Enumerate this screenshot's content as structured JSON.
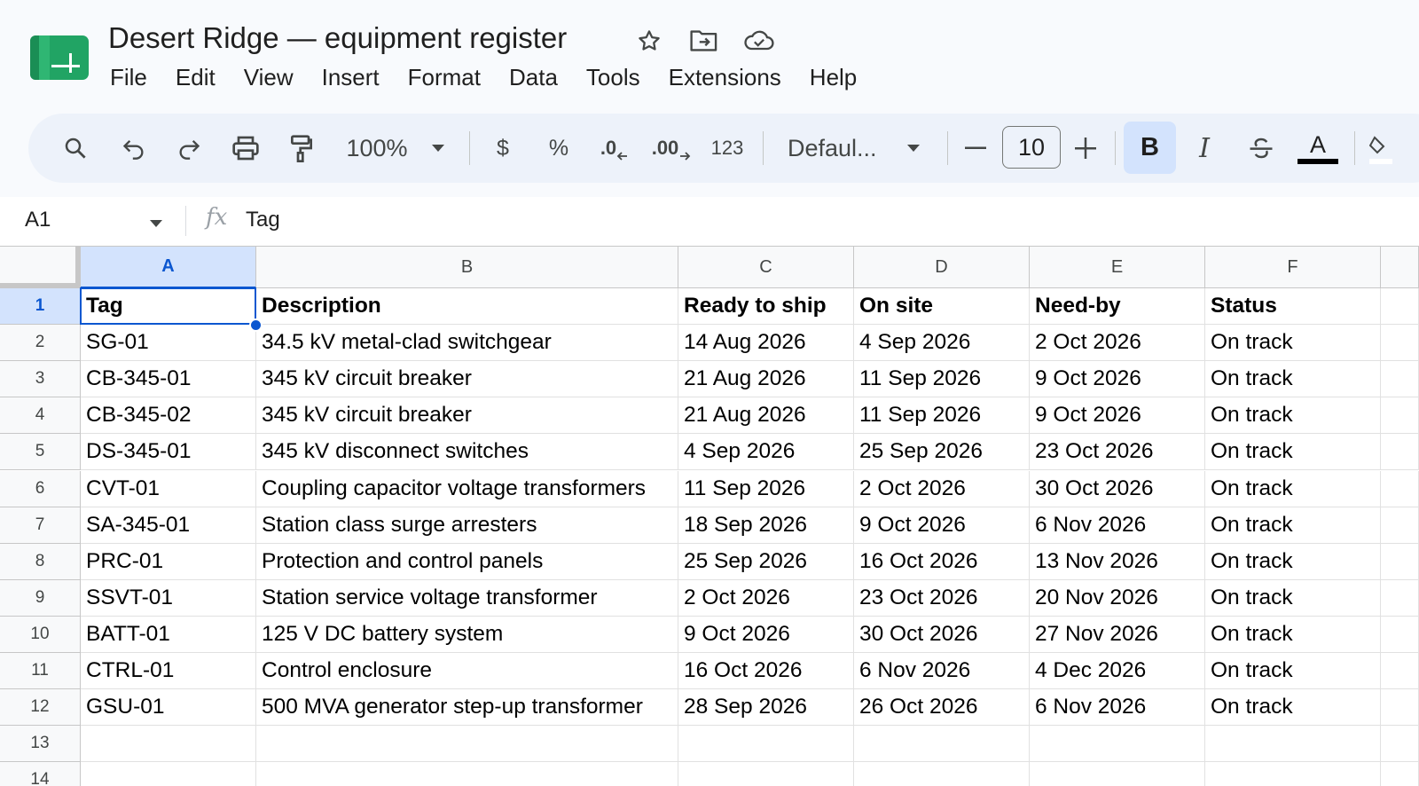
{
  "app": {
    "title": "Desert Ridge — equipment register",
    "brand_color": "#0f9d58"
  },
  "menu": [
    "File",
    "Edit",
    "View",
    "Insert",
    "Format",
    "Data",
    "Tools",
    "Extensions",
    "Help"
  ],
  "toolbar": {
    "zoom": "100%",
    "currency_label": "$",
    "percent_label": "%",
    "decrease_decimal_label": ".0",
    "increase_decimal_label": ".00",
    "more_formats_label": "123",
    "font_name": "Defaul...",
    "font_size": "10",
    "bold_label": "B",
    "italic_label": "I",
    "text_color_label": "A",
    "bold_active": true
  },
  "formula_bar": {
    "cell_ref": "A1",
    "fx_label": "fx",
    "content": "Tag"
  },
  "sheet": {
    "columns": [
      "A",
      "B",
      "C",
      "D",
      "E",
      "F"
    ],
    "row_numbers": [
      "1",
      "2",
      "3",
      "4",
      "5",
      "6",
      "7",
      "8",
      "9",
      "10",
      "11",
      "12",
      "13",
      "14"
    ],
    "selected_cell": "A1",
    "rows": [
      [
        "Tag",
        "Description",
        "Ready to ship",
        "On site",
        "Need-by",
        "Status"
      ],
      [
        "SG-01",
        "34.5 kV metal-clad switchgear",
        "14 Aug 2026",
        "4 Sep 2026",
        "2 Oct 2026",
        "On track"
      ],
      [
        "CB-345-01",
        "345 kV circuit breaker",
        "21 Aug 2026",
        "11 Sep 2026",
        "9 Oct 2026",
        "On track"
      ],
      [
        "CB-345-02",
        "345 kV circuit breaker",
        "21 Aug 2026",
        "11 Sep 2026",
        "9 Oct 2026",
        "On track"
      ],
      [
        "DS-345-01",
        "345 kV disconnect switches",
        "4 Sep 2026",
        "25 Sep 2026",
        "23 Oct 2026",
        "On track"
      ],
      [
        "CVT-01",
        "Coupling capacitor voltage transformers",
        "11 Sep 2026",
        "2 Oct 2026",
        "30 Oct 2026",
        "On track"
      ],
      [
        "SA-345-01",
        "Station class surge arresters",
        "18 Sep 2026",
        "9 Oct 2026",
        "6 Nov 2026",
        "On track"
      ],
      [
        "PRC-01",
        "Protection and control panels",
        "25 Sep 2026",
        "16 Oct 2026",
        "13 Nov 2026",
        "On track"
      ],
      [
        "SSVT-01",
        "Station service voltage transformer",
        "2 Oct 2026",
        "23 Oct 2026",
        "20 Nov 2026",
        "On track"
      ],
      [
        "BATT-01",
        "125 V DC battery system",
        "9 Oct 2026",
        "30 Oct 2026",
        "27 Nov 2026",
        "On track"
      ],
      [
        "CTRL-01",
        "Control enclosure",
        "16 Oct 2026",
        "6 Nov 2026",
        "4 Dec 2026",
        "On track"
      ],
      [
        "GSU-01",
        "500 MVA generator step-up transformer",
        "28 Sep 2026",
        "26 Oct 2026",
        "6 Nov 2026",
        "On track"
      ],
      [
        "",
        "",
        "",
        "",
        "",
        ""
      ],
      [
        "",
        "",
        "",
        "",
        "",
        ""
      ]
    ]
  }
}
